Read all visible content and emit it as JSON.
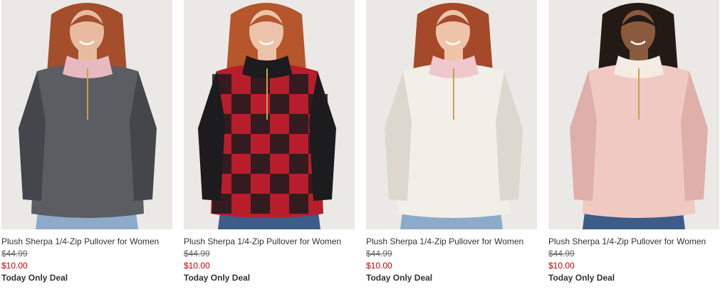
{
  "products": [
    {
      "title": "Plush Sherpa 1/4-Zip Pullover for Women",
      "was_price": "$44.99",
      "sale_price": "$10.00",
      "badge": "Today Only Deal",
      "image": {
        "description": "Woman with long auburn hair wearing a charcoal gray sherpa quarter-zip pullover with pink collar lining",
        "garment": "#5c5d62",
        "garment_dark": "#45464b",
        "collar": "#e8b9c1",
        "hair": "#a44e2c",
        "skin": "#e8bba0",
        "pants": "#8eaacb"
      }
    },
    {
      "title": "Plush Sherpa 1/4-Zip Pullover for Women",
      "was_price": "$44.99",
      "sale_price": "$10.00",
      "badge": "Today Only Deal",
      "image": {
        "description": "Woman with auburn hair and bangs wearing a red and black buffalo plaid sherpa quarter-zip pullover",
        "garment": "#b81d2b",
        "garment_dark": "#1c1b1d",
        "collar": "#1c1b1d",
        "hair": "#b5562c",
        "skin": "#ecc3a8",
        "pants": "#3d5c88"
      }
    },
    {
      "title": "Plush Sherpa 1/4-Zip Pullover for Women",
      "was_price": "$44.99",
      "sale_price": "$10.00",
      "badge": "Today Only Deal",
      "image": {
        "description": "Woman with auburn hair wearing a cream white sherpa quarter-zip pullover with pink collar lining",
        "garment": "#f2efe8",
        "garment_dark": "#dcd8cf",
        "collar": "#efc7cd",
        "hair": "#a5492a",
        "skin": "#eec4a8",
        "pants": "#8eaacb"
      }
    },
    {
      "title": "Plush Sherpa 1/4-Zip Pullover for Women",
      "was_price": "$44.99",
      "sale_price": "$10.00",
      "badge": "Today Only Deal",
      "image": {
        "description": "Woman with dark hair wearing a blush pink sherpa quarter-zip pullover with cream collar lining",
        "garment": "#f0c9c3",
        "garment_dark": "#dfb0aa",
        "collar": "#f4ece2",
        "hair": "#231915",
        "skin": "#8a5a3e",
        "pants": "#3d5c88"
      }
    }
  ],
  "colors": {
    "sale_price": "#cc0000",
    "text": "#333333",
    "was_price": "#666666"
  }
}
